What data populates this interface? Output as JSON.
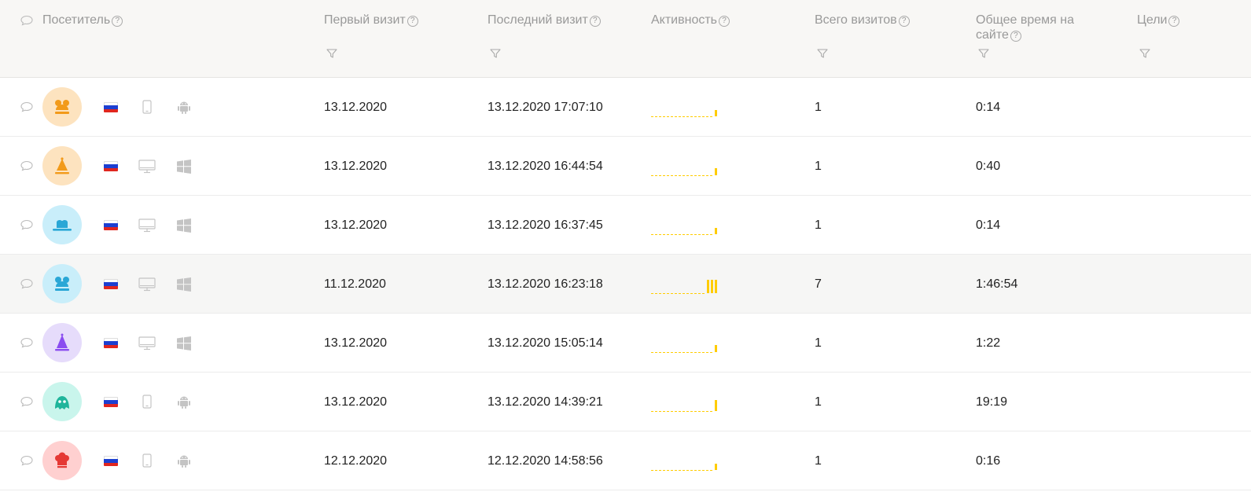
{
  "header": {
    "visitor": "Посетитель",
    "first_visit": "Первый визит",
    "last_visit": "Последний визит",
    "activity": "Активность",
    "total_visits": "Всего визитов",
    "total_time_line1": "Общее время на",
    "total_time_line2": "сайте",
    "goals": "Цели",
    "help_glyph": "?"
  },
  "rows": [
    {
      "first_visit": "13.12.2020",
      "last_visit": "13.12.2020 17:07:10",
      "visits": "1",
      "time": "0:14",
      "avatar_icon": "bear-ears-hat-icon",
      "avatar_bg": "#fde3bf",
      "avatar_color": "#f29a1a",
      "device": "phone-icon",
      "os": "android-icon",
      "activity_bars": 1,
      "activity_level": 0.45
    },
    {
      "first_visit": "13.12.2020",
      "last_visit": "13.12.2020 16:44:54",
      "visits": "1",
      "time": "0:40",
      "avatar_icon": "cone-hat-icon",
      "avatar_bg": "#fde3bf",
      "avatar_color": "#f29a1a",
      "device": "desktop-icon",
      "os": "windows-icon",
      "activity_bars": 1,
      "activity_level": 0.55
    },
    {
      "first_visit": "13.12.2020",
      "last_visit": "13.12.2020 16:37:45",
      "visits": "1",
      "time": "0:14",
      "avatar_icon": "bowler-hat-icon",
      "avatar_bg": "#c9eefa",
      "avatar_color": "#2aa7d6",
      "device": "desktop-icon",
      "os": "windows-icon",
      "activity_bars": 1,
      "activity_level": 0.45
    },
    {
      "first_visit": "11.12.2020",
      "last_visit": "13.12.2020 16:23:18",
      "visits": "7",
      "time": "1:46:54",
      "avatar_icon": "bear-ears-hat-icon",
      "avatar_bg": "#c9eefa",
      "avatar_color": "#2aa7d6",
      "device": "desktop-icon",
      "os": "windows-icon",
      "activity_bars": 3,
      "activity_level": 1.0
    },
    {
      "first_visit": "13.12.2020",
      "last_visit": "13.12.2020 15:05:14",
      "visits": "1",
      "time": "1:22",
      "avatar_icon": "wizard-hat-icon",
      "avatar_bg": "#e6dcfb",
      "avatar_color": "#8a4cf0",
      "device": "desktop-icon",
      "os": "windows-icon",
      "activity_bars": 1,
      "activity_level": 0.55
    },
    {
      "first_visit": "13.12.2020",
      "last_visit": "13.12.2020 14:39:21",
      "visits": "1",
      "time": "19:19",
      "avatar_icon": "helmet-mask-icon",
      "avatar_bg": "#c9f5ec",
      "avatar_color": "#1fb59b",
      "device": "phone-icon",
      "os": "android-icon",
      "activity_bars": 1,
      "activity_level": 0.8
    },
    {
      "first_visit": "12.12.2020",
      "last_visit": "12.12.2020 14:58:56",
      "visits": "1",
      "time": "0:16",
      "avatar_icon": "chef-hat-icon",
      "avatar_bg": "#ffd0d0",
      "avatar_color": "#e53935",
      "device": "phone-icon",
      "os": "android-icon",
      "activity_bars": 1,
      "activity_level": 0.45
    }
  ],
  "colors": {
    "header_bg": "#f8f7f5",
    "activity": "#ffcc00",
    "icon_gray": "#bdbdbd",
    "highlight_row": "#f6f6f5"
  }
}
